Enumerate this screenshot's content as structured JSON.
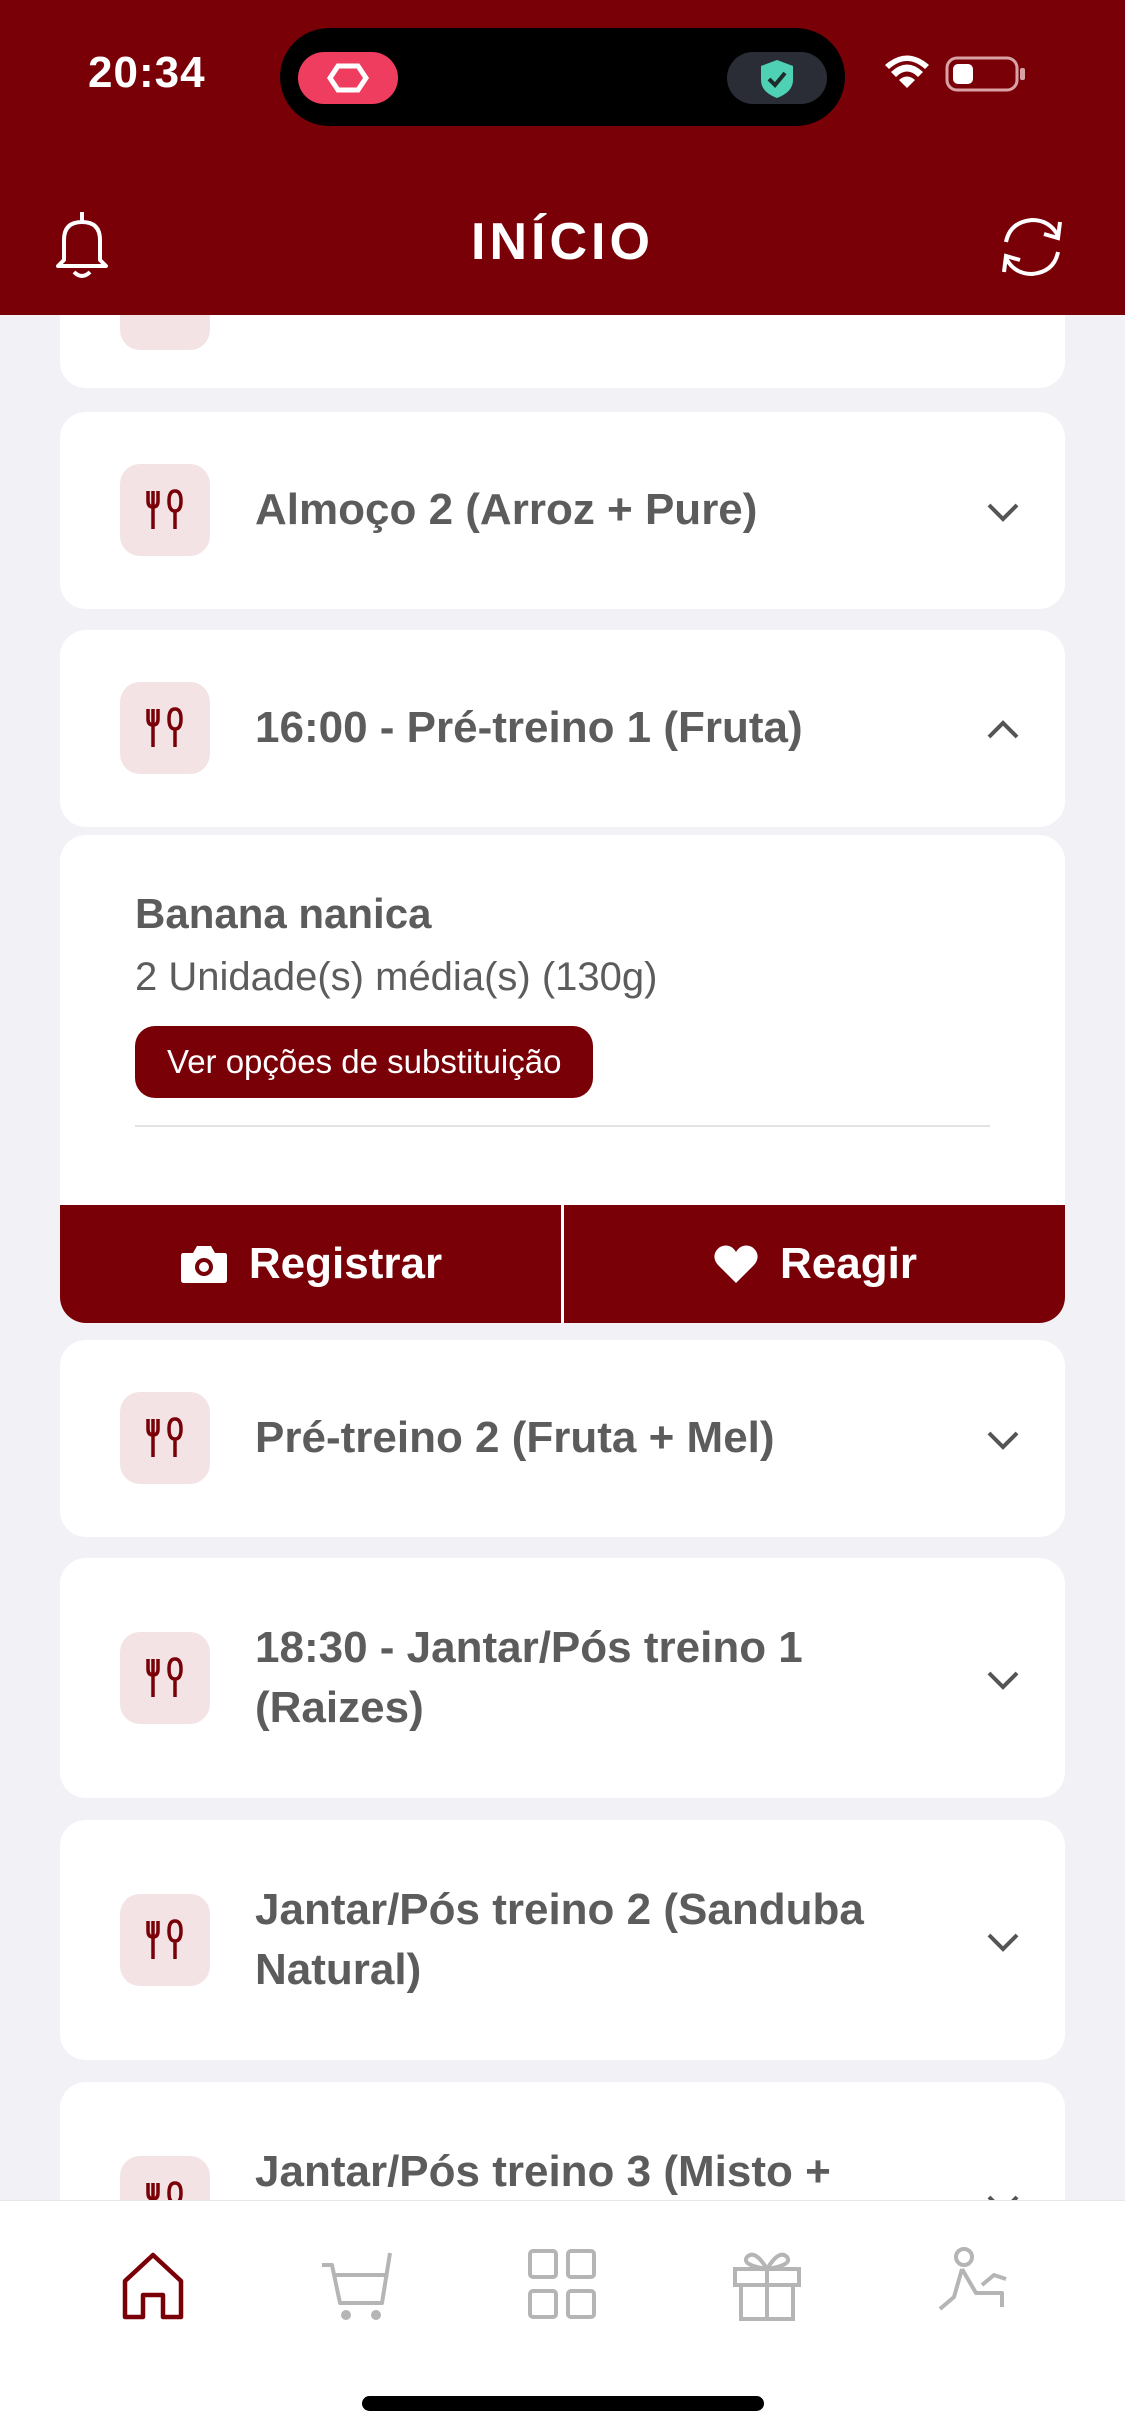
{
  "status": {
    "time": "20:34"
  },
  "header": {
    "title": "INÍCIO"
  },
  "meals": [
    {
      "title": "Almoço 2 (Arroz + Pure)",
      "expanded": false
    },
    {
      "title": "16:00 - Pré-treino 1 (Fruta)",
      "expanded": true
    },
    {
      "title": "Pré-treino 2 (Fruta + Mel)",
      "expanded": false
    },
    {
      "title": "18:30 - Jantar/Pós treino 1 (Raizes)",
      "expanded": false
    },
    {
      "title": "Jantar/Pós treino 2 (Sanduba Natural)",
      "expanded": false
    },
    {
      "title": "Jantar/Pós treino 3 (Misto +",
      "expanded": false
    }
  ],
  "detail": {
    "food_name": "Banana nanica",
    "quantity": "2 Unidade(s) média(s) (130g)",
    "substitution_label": "Ver opções de substituição",
    "register_label": "Registrar",
    "react_label": "Reagir"
  },
  "tabbar": {
    "items": [
      {
        "icon": "home-icon",
        "active": true
      },
      {
        "icon": "cart-icon",
        "active": false
      },
      {
        "icon": "grid-icon",
        "active": false
      },
      {
        "icon": "gift-icon",
        "active": false
      },
      {
        "icon": "exercise-icon",
        "active": false
      }
    ]
  },
  "colors": {
    "brand": "#7a0008",
    "icon_bg": "#f3e3e4",
    "background": "#f2f1f6"
  }
}
